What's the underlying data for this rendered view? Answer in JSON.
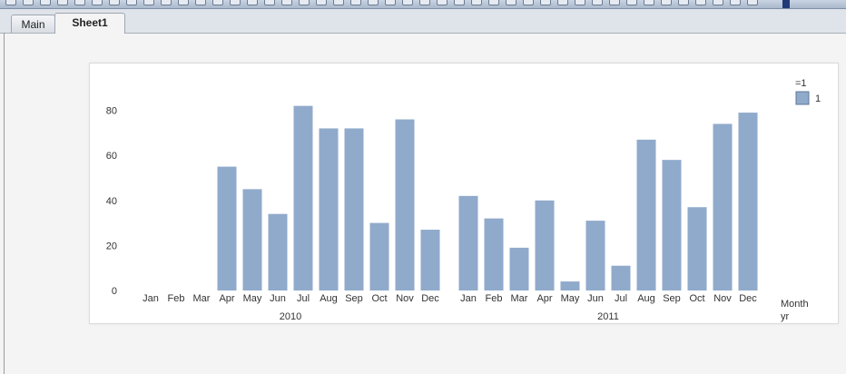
{
  "tabs": [
    {
      "label": "Main",
      "active": false
    },
    {
      "label": "Sheet1",
      "active": true
    }
  ],
  "colors": {
    "bar": "#90aacb",
    "bar_stroke": "#7f98ba"
  },
  "chart_data": {
    "type": "bar",
    "groups": [
      {
        "label": "2010",
        "categories": [
          "Jan",
          "Feb",
          "Mar",
          "Apr",
          "May",
          "Jun",
          "Jul",
          "Aug",
          "Sep",
          "Oct",
          "Nov",
          "Dec"
        ],
        "values": [
          0,
          0,
          0,
          55,
          45,
          34,
          82,
          72,
          72,
          30,
          76,
          27
        ]
      },
      {
        "label": "2011",
        "categories": [
          "Jan",
          "Feb",
          "Mar",
          "Apr",
          "May",
          "Jun",
          "Jul",
          "Aug",
          "Sep",
          "Oct",
          "Nov",
          "Dec"
        ],
        "values": [
          42,
          32,
          19,
          40,
          4,
          31,
          11,
          67,
          58,
          37,
          74,
          79
        ]
      }
    ],
    "yticks": [
      "0",
      "20",
      "40",
      "60",
      "80"
    ],
    "ylim": [
      0,
      90
    ],
    "xlabel_1": "Month",
    "xlabel_2": "yr",
    "legend": {
      "title": "=1",
      "items": [
        "1"
      ],
      "position": "top-right"
    },
    "grid": false
  }
}
